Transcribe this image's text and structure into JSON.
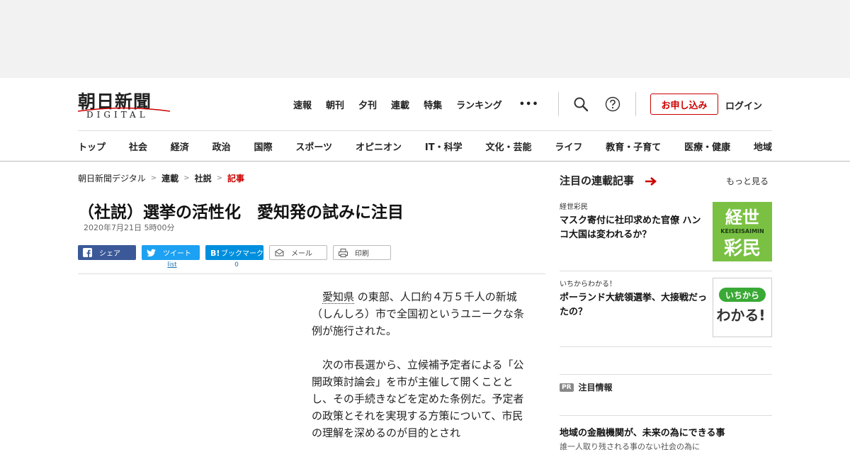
{
  "header": {
    "logo_text": "朝日新聞",
    "logo_sub": "DIGITAL",
    "top_nav": [
      "速報",
      "朝刊",
      "夕刊",
      "連載",
      "特集",
      "ランキング"
    ],
    "more_label": "•••",
    "apply_label": "お申し込み",
    "login_label": "ログイン",
    "categories": [
      "トップ",
      "社会",
      "経済",
      "政治",
      "国際",
      "スポーツ",
      "オピニオン",
      "IT・科学",
      "文化・芸能",
      "ライフ",
      "教育・子育て",
      "医療・健康",
      "地域"
    ]
  },
  "breadcrumb": {
    "items": [
      "朝日新聞デジタル",
      "連載",
      "社説"
    ],
    "current": "記事",
    "separator": ">"
  },
  "article": {
    "headline": "（社説）選挙の活性化　愛知発の試みに注目",
    "date": "2020年7月21日 5時00分",
    "share": {
      "facebook": "シェア",
      "twitter": "ツイート",
      "twitter_count": "list",
      "hatena": "ブックマーク",
      "hatena_count": "0",
      "mail": "メール",
      "print": "印刷"
    },
    "para1_kw": "愛知県",
    "para1_rest": "の東部、人口約４万５千人の新城（しんしろ）市で全国初というユニークな条例が施行された。",
    "para2": "次の市長選から、立候補予定者による「公開政策討論会」を市が主催して開くこととし、その手続きなどを定めた条例だ。予定者の政策とそれを実現する方策について、市民の理解を深めるのが目的とされ"
  },
  "sidebar": {
    "title": "注目の連載記事",
    "more_label": "もっと見る",
    "items": [
      {
        "kicker": "経世彩民",
        "title": "マスク寄付に社印求めた官僚 ハンコ大国は変われるか？",
        "thumb_top": "経世",
        "thumb_mid": "KEISEISAIMIN",
        "thumb_bottom": "彩民"
      },
      {
        "kicker": "いちからわかる！",
        "title": "ポーランド大統領選挙、大接戦だったの？",
        "thumb_top": "いちから",
        "thumb_bottom": "わかる!"
      }
    ],
    "pr_badge": "PR",
    "pr_label": "注目情報",
    "pr_story": "地域の金融機関が、未来の為にできる事",
    "pr_story_sub": "誰一人取り残される事のない社会の為に"
  },
  "colors": {
    "accent_red": "#cc0000",
    "facebook": "#3b5998",
    "twitter": "#1da1f2",
    "hatena": "#008fde",
    "keisei_green": "#7ac143",
    "ichikara_green": "#3aa935"
  }
}
